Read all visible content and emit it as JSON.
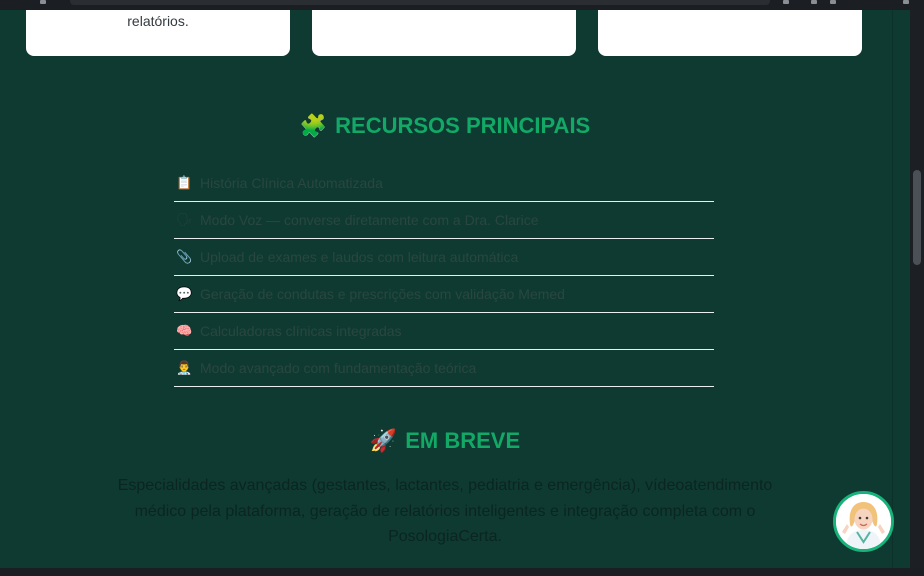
{
  "cards": [
    {
      "text": "relatórios."
    },
    {
      "text": ""
    },
    {
      "text": ""
    }
  ],
  "features_section": {
    "emoji": "🧩",
    "title": "RECURSOS PRINCIPAIS",
    "items": [
      {
        "icon": "📋",
        "icon_name": "clipboard-icon",
        "text": "História Clínica Automatizada"
      },
      {
        "icon": "🗣",
        "icon_name": "speaking-head-icon",
        "text": "Modo Voz — converse diretamente com a Dra. Clarice"
      },
      {
        "icon": "📎",
        "icon_name": "paperclip-icon",
        "text": "Upload de exames e laudos com leitura automática"
      },
      {
        "icon": "💬",
        "icon_name": "speech-bubble-icon",
        "text": "Geração de condutas e prescrições com validação Memed"
      },
      {
        "icon": "🧠",
        "icon_name": "brain-icon",
        "text": "Calculadoras clínicas integradas"
      },
      {
        "icon": "👨‍⚕️",
        "icon_name": "health-worker-icon",
        "text": "Modo avançado com fundamentação teórica"
      }
    ]
  },
  "soon_section": {
    "emoji": "🚀",
    "title": "EM BREVE",
    "text": "Especialidades avançadas (gestantes, lactantes, pediatria e emergência), vídeoatendimento médico pela plataforma, geração de relatórios inteligentes e integração completa com o PosologiaCerta."
  },
  "colors": {
    "background": "#0f3a32",
    "accent": "#12a866",
    "card": "#ffffff"
  }
}
